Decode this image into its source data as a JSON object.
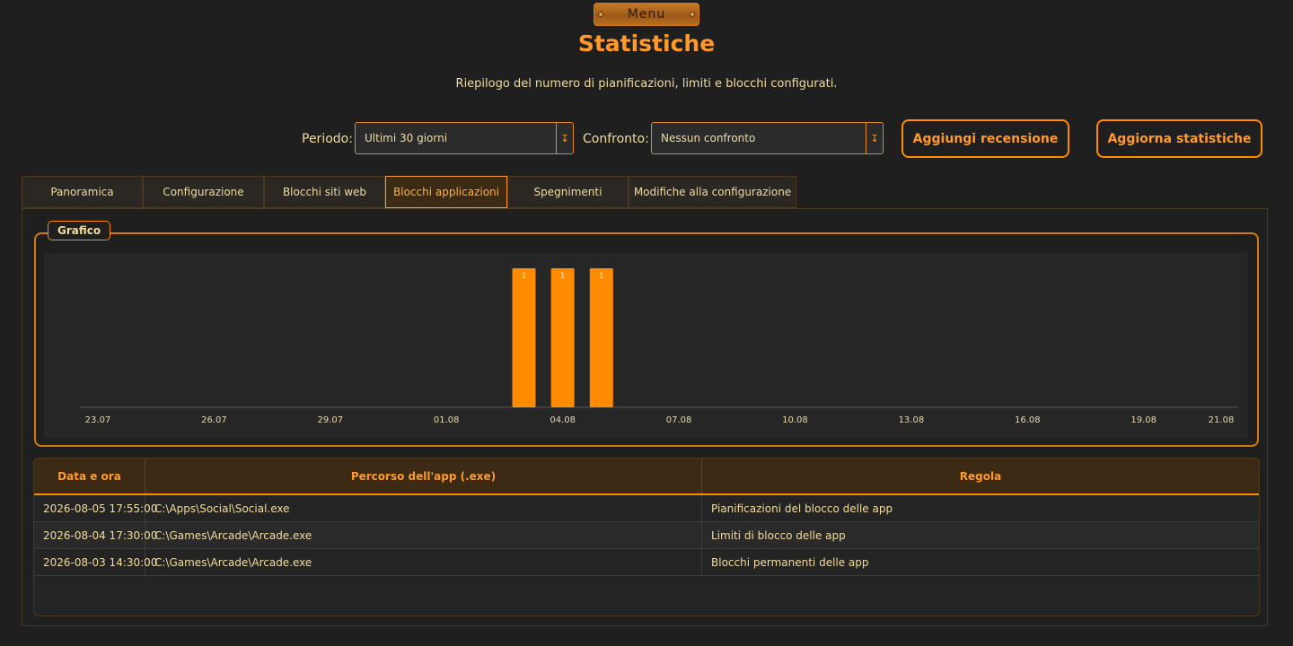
{
  "header": {
    "menu_label": "Menu",
    "title": "Statistiche",
    "subtitle": "Riepilogo del numero di pianificazioni, limiti e blocchi configurati."
  },
  "filters": {
    "period_label": "Periodo:",
    "period_value": "Ultimi 30 giorni",
    "compare_label": "Confronto:",
    "compare_value": "Nessun confronto",
    "add_review_label": "Aggiungi recensione",
    "refresh_label": "Aggiorna statistiche"
  },
  "tabs": [
    {
      "label": "Panoramica",
      "active": false
    },
    {
      "label": "Configurazione",
      "active": false
    },
    {
      "label": "Blocchi siti web",
      "active": false
    },
    {
      "label": "Blocchi applicazioni",
      "active": true
    },
    {
      "label": "Spegnimenti",
      "active": false
    },
    {
      "label": "Modifiche alla configurazione",
      "active": false
    }
  ],
  "chart_group_title": "Grafico",
  "chart_data": {
    "type": "bar",
    "title": "",
    "xlabel": "",
    "ylabel": "",
    "x_tick_labels": [
      "23.07",
      "26.07",
      "29.07",
      "01.08",
      "04.08",
      "07.08",
      "10.08",
      "13.08",
      "16.08",
      "19.08",
      "21.08"
    ],
    "x_range": [
      "23.07",
      "21.08"
    ],
    "bars": [
      {
        "date": "03.08",
        "value": 1
      },
      {
        "date": "04.08",
        "value": 1
      },
      {
        "date": "05.08",
        "value": 1
      }
    ],
    "ylim": [
      0,
      1
    ],
    "grid": false,
    "bar_color": "#ff8c00"
  },
  "table": {
    "headers": [
      "Data e ora",
      "Percorso dell'app (.exe)",
      "Regola"
    ],
    "rows": [
      [
        "2026-08-05 17:55:00",
        "C:\\Apps\\Social\\Social.exe",
        "Pianificazioni del blocco delle app"
      ],
      [
        "2026-08-04 17:30:00",
        "C:\\Games\\Arcade\\Arcade.exe",
        "Limiti di blocco delle app"
      ],
      [
        "2026-08-03 14:30:00",
        "C:\\Games\\Arcade\\Arcade.exe",
        "Blocchi permanenti delle app"
      ]
    ]
  },
  "colors": {
    "accent": "#ff8c00",
    "background": "#1f1f1f",
    "text": "#f0dca0"
  }
}
